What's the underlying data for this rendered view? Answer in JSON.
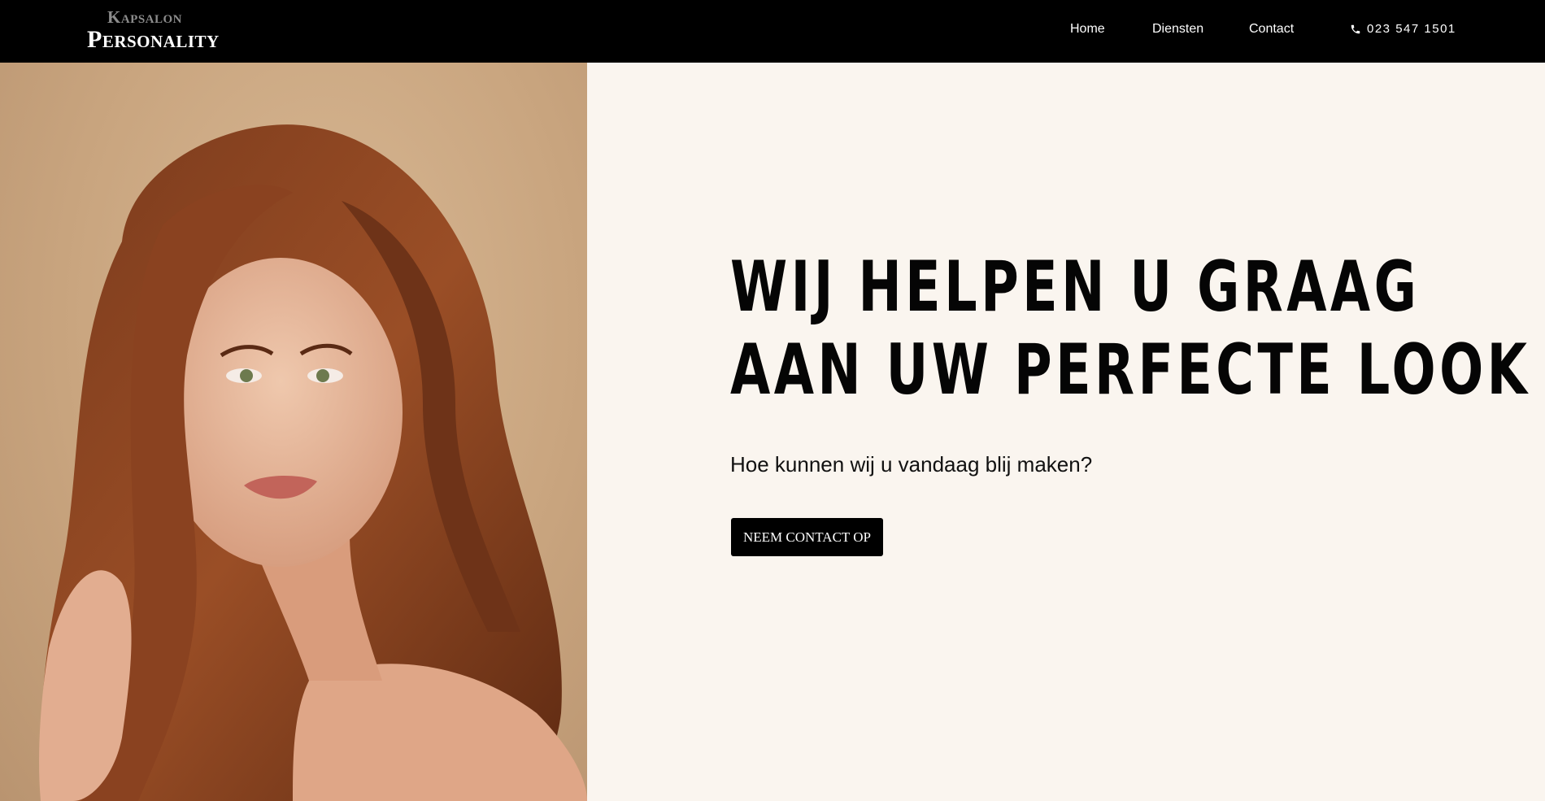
{
  "header": {
    "logo": {
      "top_text": "Kapsalon",
      "bottom_text": "Personality"
    },
    "nav": [
      {
        "label": "Home"
      },
      {
        "label": "Diensten"
      },
      {
        "label": "Contact"
      }
    ],
    "phone": {
      "icon": "phone-icon",
      "number": "023 547 1501"
    }
  },
  "hero": {
    "title_line_1": "WIJ HELPEN U GRAAG",
    "title_line_2": "AAN UW PERFECTE LOOK",
    "subtitle": "Hoe kunnen wij u vandaag blij maken?",
    "cta_label": "NEEM CONTACT OP"
  },
  "colors": {
    "header_bg": "#000000",
    "page_bg": "#faf5ef",
    "image_bg": "#c9a57f",
    "button_bg": "#000000",
    "text": "#050505"
  }
}
